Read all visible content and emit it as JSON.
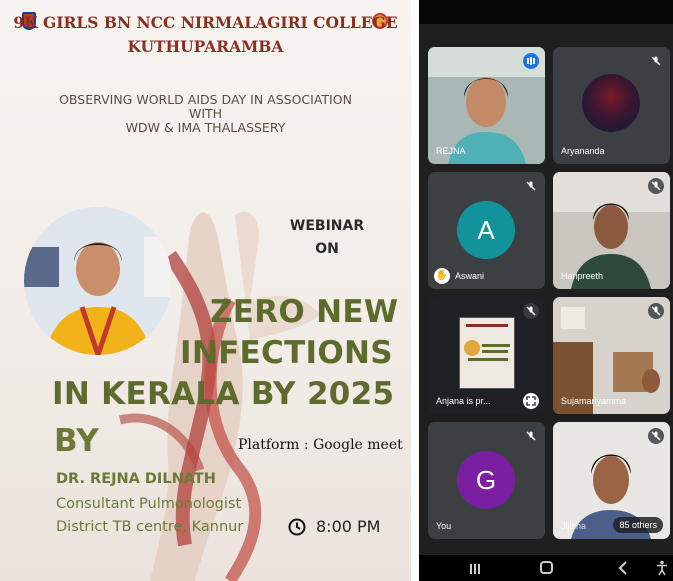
{
  "poster": {
    "header_line1": "9K GIRLS BN NCC NIRMALAGIRI COLLEGE",
    "header_line2": "KUTHUPARAMBA",
    "sub_line1": "OBSERVING  WORLD AIDS DAY IN ASSOCIATION",
    "sub_line2": "WITH",
    "sub_line3": "WDW & IMA THALASSERY",
    "webinar_line1": "WEBINAR",
    "webinar_line2": "ON",
    "title_line1": "ZERO NEW",
    "title_line2": "INFECTIONS",
    "title_line3": "IN KERALA BY 2025",
    "by_label": "BY",
    "platform": "Platform : Google meet",
    "speaker_name": "DR. REJNA DILNATH",
    "speaker_role": "Consultant Pulmonologist",
    "speaker_org": "District TB centre, Kannur",
    "time": "8:00 PM",
    "accent_color": "#5d6b2c",
    "header_color": "#8a2e21"
  },
  "meet": {
    "participants": [
      {
        "name": "REJNA",
        "icon": "speaking-icon"
      },
      {
        "name": "Aryananda",
        "icon": "mic-off-icon"
      },
      {
        "name": "Aswani",
        "avatar": "A",
        "icon": "mic-off-icon",
        "extra_icon": "raised-hand-icon"
      },
      {
        "name": "Haripreeth",
        "icon": "mic-off-icon"
      },
      {
        "name": "Anjana is pr...",
        "icon": "mic-off-icon",
        "extra_icon": "fullscreen-icon"
      },
      {
        "name": "Sujamariyamma",
        "icon": "mic-off-icon"
      },
      {
        "name": "You",
        "avatar": "G",
        "icon": "mic-off-icon"
      },
      {
        "name": "Jijisha",
        "icon": "mic-off-icon"
      }
    ],
    "others_label": "85 others"
  }
}
